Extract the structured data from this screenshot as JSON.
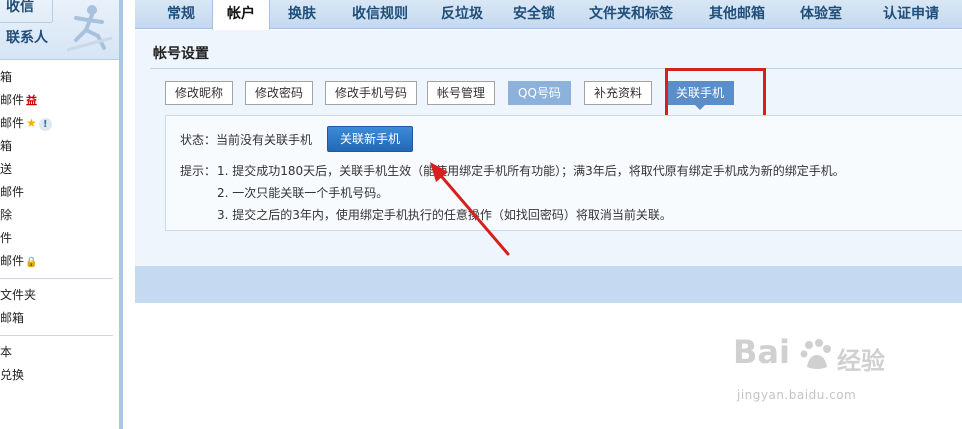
{
  "sidebar": {
    "compose": "收信",
    "contacts": "联系人",
    "items": [
      {
        "label": "箱"
      },
      {
        "label": "邮件",
        "badge": "益"
      },
      {
        "label": "邮件",
        "star": "★",
        "info": "!"
      },
      {
        "label": "箱"
      },
      {
        "label": "送"
      },
      {
        "label": "邮件"
      },
      {
        "label": "除"
      },
      {
        "label": "件"
      },
      {
        "label": "邮件",
        "lock": "🔒"
      }
    ],
    "items2": [
      {
        "label": "文件夹"
      },
      {
        "label": "邮箱"
      }
    ],
    "items3": [
      {
        "label": "本"
      },
      {
        "label": "兑换"
      }
    ]
  },
  "topnav": {
    "tabs": [
      {
        "label": "常规"
      },
      {
        "label": "帐户"
      },
      {
        "label": "换肤"
      },
      {
        "label": "收信规则"
      },
      {
        "label": "反垃圾"
      },
      {
        "label": "安全锁"
      },
      {
        "label": "文件夹和标签"
      },
      {
        "label": "其他邮箱"
      },
      {
        "label": "体验室"
      },
      {
        "label": "认证申请"
      }
    ],
    "active_index": 1
  },
  "panel": {
    "title": "帐号设置",
    "subtabs": [
      {
        "label": "修改昵称"
      },
      {
        "label": "修改密码"
      },
      {
        "label": "修改手机号码"
      },
      {
        "label": "帐号管理"
      },
      {
        "label": "QQ号码"
      },
      {
        "label": "补充资料"
      },
      {
        "label": "关联手机"
      }
    ],
    "status_label": "状态：当前没有关联手机",
    "link_button": "关联新手机",
    "tip_label": "提示：",
    "tips": [
      "1. 提交成功180天后，关联手机生效（能使用绑定手机所有功能）；满3年后，将取代原有绑定手机成为新的绑定手机。",
      "2. 一次只能关联一个手机号码。",
      "3. 提交之后的3年内，使用绑定手机执行的任意操作（如找回密码）将取消当前关联。"
    ]
  },
  "watermark": {
    "brand": "Bai",
    "brand_cn": "经验",
    "url": "jingyan.baidu.com"
  },
  "colors": {
    "nav_bg": "#c4d9ee",
    "panel_bg": "#eef5fc",
    "active_subtab": "#5b8ec9",
    "primary_button": "#2268b5",
    "highlight": "#d62020"
  }
}
